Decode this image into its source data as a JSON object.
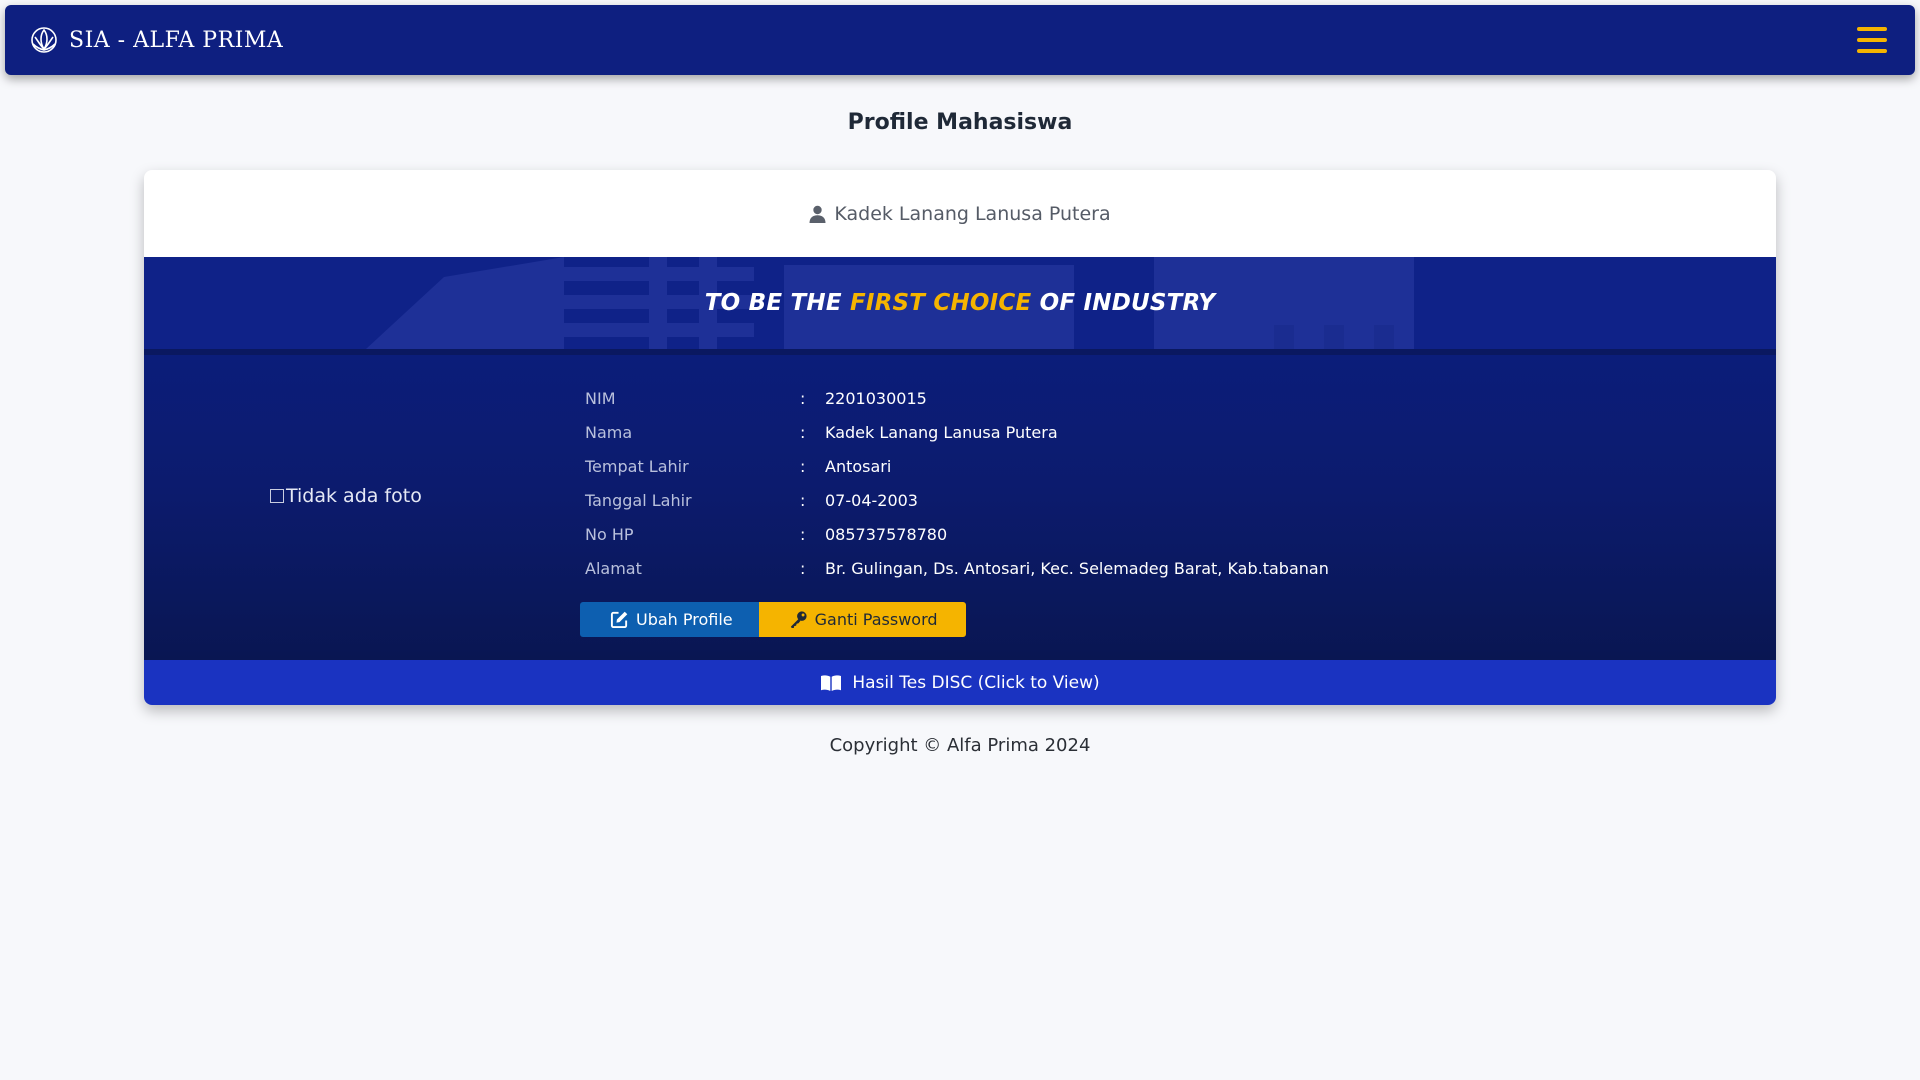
{
  "navbar": {
    "brand": "SIA - ALFA PRIMA",
    "logo_icon": "lotus-logo-icon",
    "menu_icon": "hamburger-menu-icon",
    "accent_color": "#f5b400",
    "background_color": "#0e1f80"
  },
  "page": {
    "title": "Profile Mahasiswa"
  },
  "card": {
    "header_name": "Kadek Lanang Lanusa Putera",
    "header_icon": "user-icon",
    "slogan": {
      "part1": "TO BE THE ",
      "highlight": "FIRST CHOICE",
      "part2": " OF INDUSTRY"
    },
    "photo_alt": "Tidak ada foto",
    "separator": ":",
    "fields": [
      {
        "label": "NIM",
        "value": "2201030015"
      },
      {
        "label": "Nama",
        "value": "Kadek Lanang Lanusa Putera"
      },
      {
        "label": "Tempat Lahir",
        "value": "Antosari"
      },
      {
        "label": "Tanggal Lahir",
        "value": "07-04-2003"
      },
      {
        "label": "No HP",
        "value": "085737578780"
      },
      {
        "label": "Alamat",
        "value": "Br. Gulingan, Ds. Antosari, Kec. Selemadeg Barat, Kab.tabanan"
      }
    ],
    "buttons": {
      "edit_label": "Ubah Profile",
      "edit_icon": "edit-icon",
      "password_label": "Ganti Password",
      "password_icon": "key-icon"
    },
    "disc": {
      "label": "Hasil Tes DISC (Click to View)",
      "icon": "book-open-icon"
    }
  },
  "footer": {
    "copyright": "Copyright © Alfa Prima 2024"
  }
}
